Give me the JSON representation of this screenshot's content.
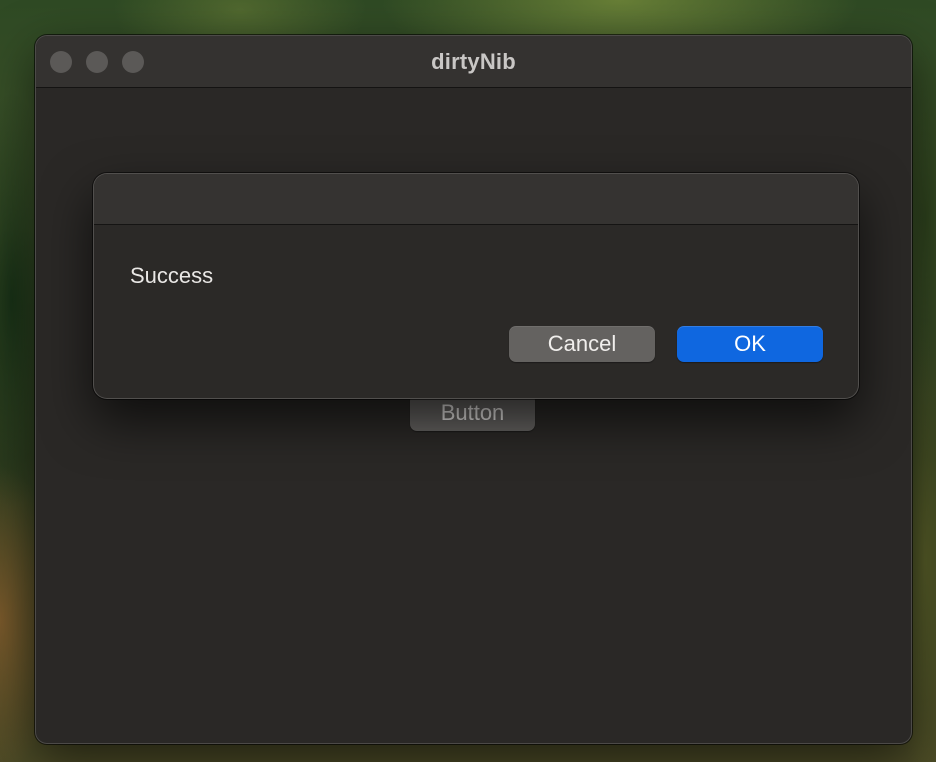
{
  "window": {
    "title": "dirtyNib"
  },
  "main": {
    "button_label": "Button"
  },
  "alert": {
    "message": "Success",
    "cancel_label": "Cancel",
    "ok_label": "OK"
  },
  "colors": {
    "accent": "#0f67e0",
    "window_bg": "#2a2826",
    "titlebar_bg": "#343230",
    "button_gray": "#646260"
  }
}
